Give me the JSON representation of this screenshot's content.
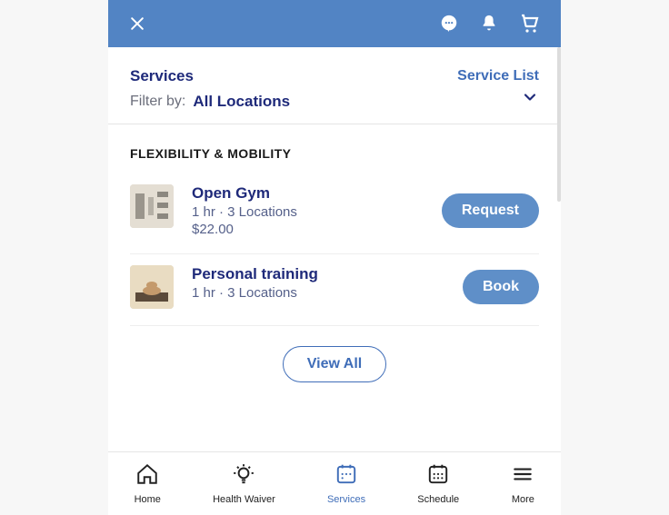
{
  "header": {
    "title": "Services",
    "link": "Service List",
    "filterLabel": "Filter by:",
    "filterValue": "All Locations"
  },
  "category": {
    "title": "FLEXIBILITY & MOBILITY"
  },
  "services": [
    {
      "name": "Open Gym",
      "meta": "1 hr · 3 Locations",
      "price": "$22.00",
      "action": "Request"
    },
    {
      "name": "Personal training",
      "meta": "1 hr · 3 Locations",
      "price": "",
      "action": "Book"
    }
  ],
  "viewAll": "View All",
  "bottomNav": {
    "home": "Home",
    "waiver": "Health Waiver",
    "services": "Services",
    "schedule": "Schedule",
    "more": "More"
  }
}
